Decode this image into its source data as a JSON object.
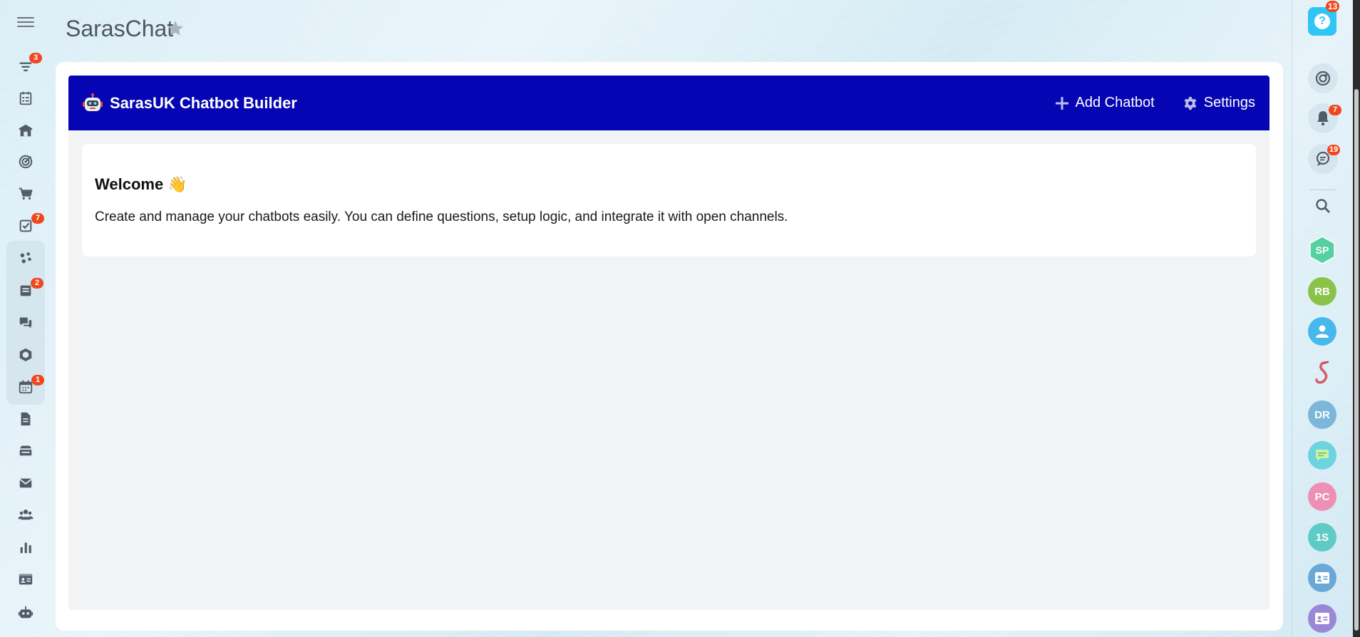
{
  "page": {
    "title": "SarasChat"
  },
  "left_sidebar": {
    "badges": {
      "filter": "3",
      "tasks": "7",
      "feed": "2",
      "calendar": "1"
    }
  },
  "builder": {
    "brand_title": "SarasUK Chatbot Builder",
    "add_chatbot_label": "Add Chatbot",
    "settings_label": "Settings",
    "accent_color": "#0505b3"
  },
  "welcome": {
    "title": "Welcome 👋",
    "text": "Create and manage your chatbots easily. You can define questions, setup logic, and integrate it with open channels."
  },
  "right_sidebar": {
    "help_badge": "13",
    "notifications_badge": "7",
    "chats_badge": "19",
    "avatars": [
      {
        "initials": "SP",
        "color": "#55d0a0"
      },
      {
        "initials": "RB",
        "color": "#8bc34a"
      },
      {
        "initials": "",
        "color": "#46b8ec"
      },
      {
        "initials": "",
        "color": "transparent"
      },
      {
        "initials": "DR",
        "color": "#7cb6d8"
      },
      {
        "initials": "",
        "color": "#6dd3e0"
      },
      {
        "initials": "PC",
        "color": "#ee8fb4"
      },
      {
        "initials": "1S",
        "color": "#5fcbc4"
      },
      {
        "initials": "",
        "color": "#6aa8d8"
      },
      {
        "initials": "",
        "color": "#9b87d6"
      }
    ]
  }
}
